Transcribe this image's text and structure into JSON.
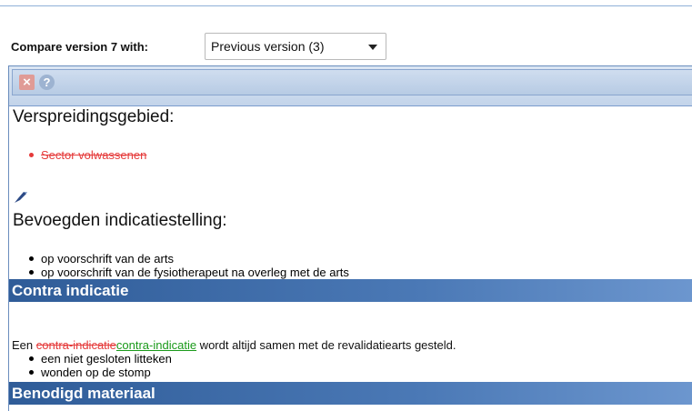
{
  "compare": {
    "label": "Compare version 7 with:",
    "selected": "Previous version (3)"
  },
  "toolbar": {
    "close_icon": "close-icon",
    "help_icon": "help-icon"
  },
  "sections": {
    "spreading": {
      "title": "Verspreidingsgebied:",
      "items": [
        {
          "deleted": "Sector volwassenen",
          "inserted": ""
        }
      ]
    },
    "authorized": {
      "title": "Bevoegden indicatiestelling:",
      "items": [
        "op voorschrift van de arts",
        "op voorschrift van de fysiotherapeut na overleg met de arts"
      ]
    },
    "contra": {
      "title": "Contra indicatie",
      "para_prefix": "Een ",
      "para_deleted": "contra-indicatie",
      "para_inserted": "contra-indicatie",
      "para_suffix": " wordt altijd samen met de revalidatiearts gesteld.",
      "items": [
        "een niet gesloten litteken",
        "wonden op de stomp"
      ]
    },
    "material": {
      "title": "Benodigd materiaal"
    }
  },
  "colors": {
    "deleted": "#e53a3a",
    "inserted": "#1a9a1a",
    "header_blue": "#2f5c98"
  }
}
